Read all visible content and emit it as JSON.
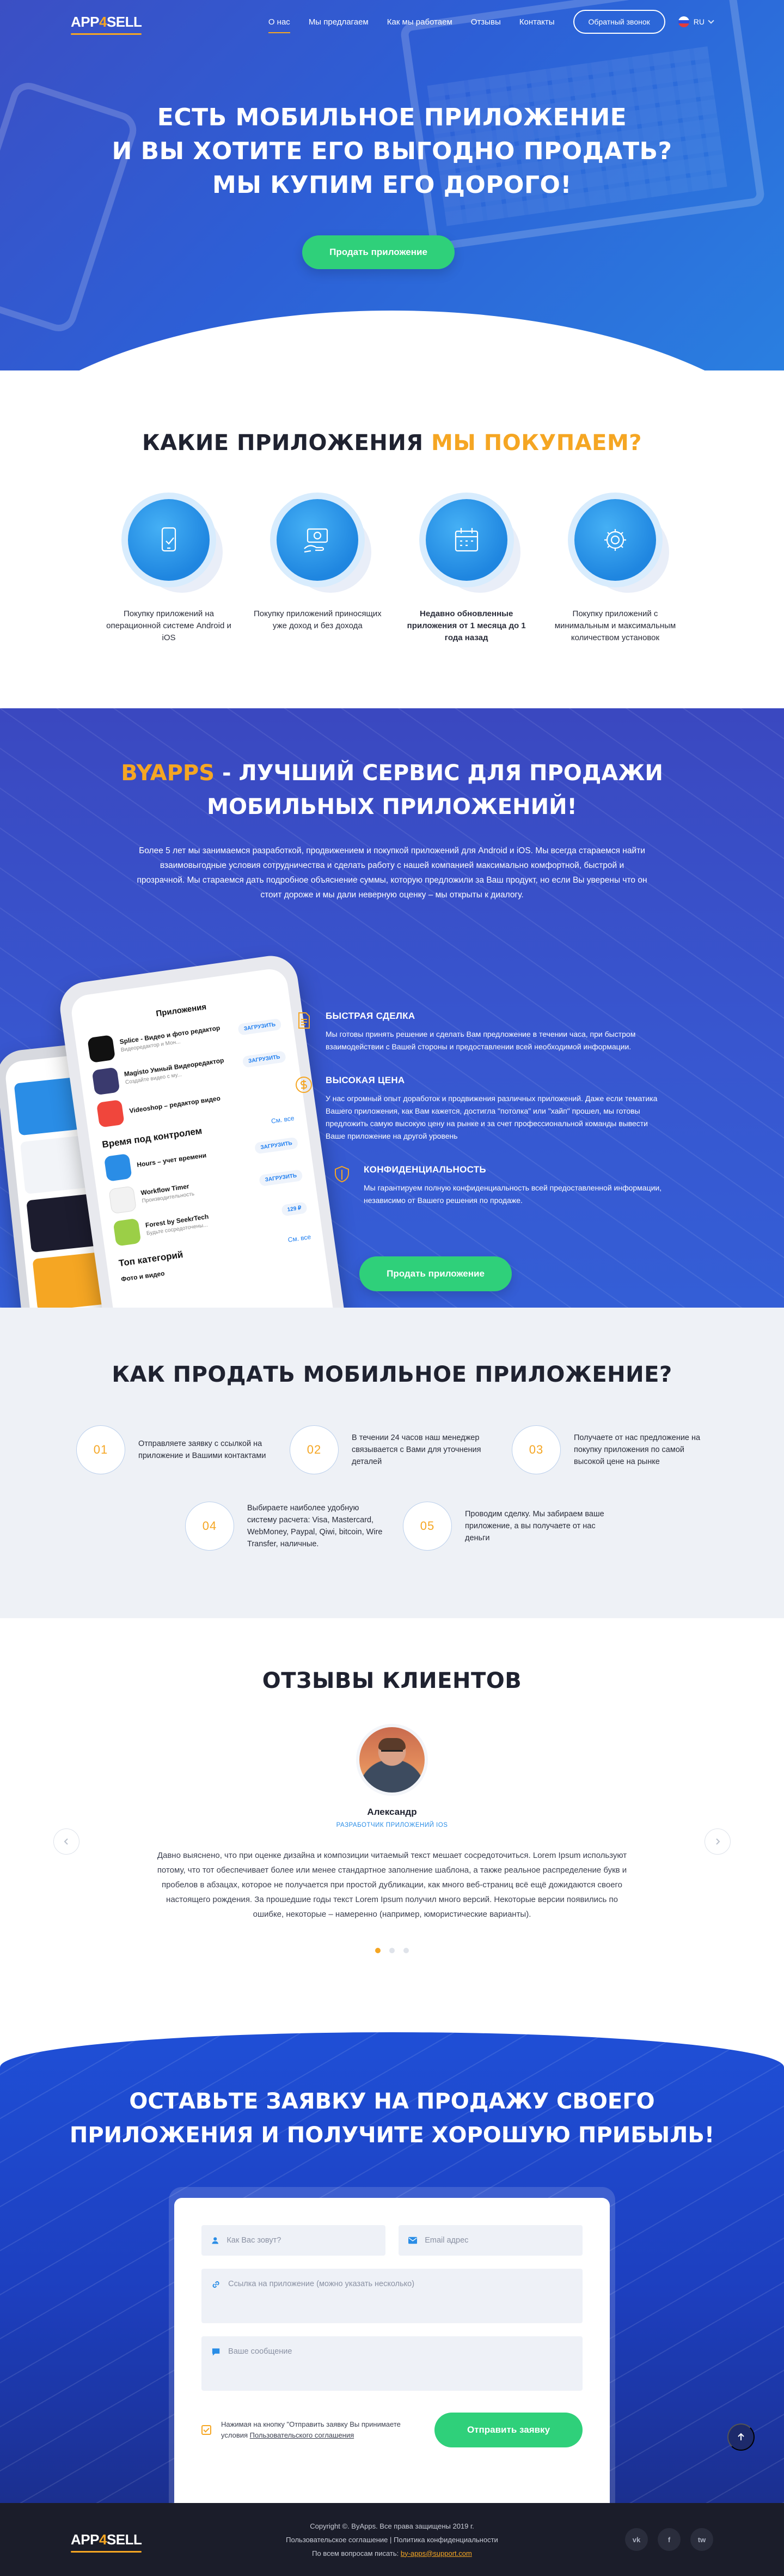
{
  "brand": {
    "logo_left": "APP",
    "logo_four": "4",
    "logo_right": "SELL"
  },
  "nav": {
    "items": [
      "О нас",
      "Мы предлагаем",
      "Как мы работаем",
      "Отзывы",
      "Контакты"
    ],
    "active_index": 0,
    "callback_label": "Обратный звонок",
    "lang": "RU"
  },
  "hero": {
    "title_lines": [
      "ЕСТЬ МОБИЛЬНОЕ ПРИЛОЖЕНИЕ",
      "И ВЫ ХОТИТЕ ЕГО ВЫГОДНО ПРОДАТЬ?",
      "МЫ КУПИМ ЕГО ДОРОГО!"
    ],
    "cta_label": "Продать приложение"
  },
  "buy": {
    "title_dark": "КАКИЕ ПРИЛОЖЕНИЯ",
    "title_orange": "МЫ ПОКУПАЕМ?",
    "features": [
      {
        "icon": "phone-check-icon",
        "text": "Покупку приложений на операционной системе Android и iOS",
        "bold": false
      },
      {
        "icon": "money-hand-icon",
        "text": "Покупку приложений приносящих уже доход и без дохода",
        "bold": false
      },
      {
        "icon": "calendar-icon",
        "text": "Недавно обновленные приложения от 1 месяца до 1 года назад",
        "bold": true
      },
      {
        "icon": "settings-gear-icon",
        "text": "Покупку приложений с минимальным и максимальным количеством установок",
        "bold": false
      }
    ]
  },
  "byapps": {
    "title_orange": "BYAPPS",
    "title_rest_1": " - ЛУЧШИЙ СЕРВИС ДЛЯ ПРОДАЖИ",
    "title_line_2": "МОБИЛЬНЫХ ПРИЛОЖЕНИЙ!",
    "lead": "Более 5 лет мы занимаемся разработкой, продвижением и покупкой приложений для Android и iOS. Мы всегда стараемся найти взаимовыгодные условия сотрудничества и сделать работу с нашей компанией максимально комфортной, быстрой и прозрачной. Мы стараемся дать подробное объяснение суммы, которую предложили за Ваш продукт, но если Вы уверены что он стоит дороже и мы дали неверную оценку – мы открыты к диалогу.",
    "benefits": [
      {
        "icon": "document-icon",
        "title": "БЫСТРАЯ СДЕЛКА",
        "text": "Мы готовы принять решение и сделать Вам предложение в течении часа, при быстром взаимодействии с Вашей стороны и предоставлении всей необходимой информации."
      },
      {
        "icon": "dollar-circle-icon",
        "title": "ВЫСОКАЯ ЦЕНА",
        "text": "У нас огромный опыт доработок и продвижения различных приложений. Даже если тематика Вашего приложения, как Вам кажется, достигла \"потолка\" или \"хайп\" прошел, мы готовы предложить самую высокую цену на рынке и за счет профессиональной команды вывести Ваше приложение на другой уровень"
      },
      {
        "icon": "shield-icon",
        "title": "КОНФИДЕНЦИАЛЬНОСТЬ",
        "text": "Мы гарантируем полную конфиденциальность всей предоставленной информации, независимо от Вашего решения по продаже."
      }
    ],
    "cta_label": "Продать приложение",
    "phone_screen": {
      "title": "Приложения",
      "apps": [
        {
          "name": "Splice - Видео и фото редактор",
          "sub": "Видеоредактор и Мон...",
          "btn": "ЗАГРУЗИТЬ",
          "color": "#111111"
        },
        {
          "name": "Magisto Умный Видеоредактор",
          "sub": "Создайте видео с му...",
          "btn": "ЗАГРУЗИТЬ",
          "color": "#3a3a6e"
        },
        {
          "name": "Videoshop – редактор видео",
          "sub": "",
          "btn": "",
          "color": "#f0463c"
        }
      ],
      "section": "Время под контролем",
      "section_link": "См. все",
      "apps2": [
        {
          "name": "Hours – учет времени",
          "sub": "",
          "btn": "ЗАГРУЗИТЬ",
          "color": "#2a8de6"
        },
        {
          "name": "Workflow Timer",
          "sub": "Производительность",
          "btn": "ЗАГРУЗИТЬ",
          "color": "#f2f2f2"
        },
        {
          "name": "Forest by SeekrTech",
          "sub": "Будьте сосредоточены...",
          "btn": "129 ₽",
          "color": "#9bcf47"
        }
      ],
      "section2": "Топ категорий",
      "section2_link": "См. все",
      "last_item": "Фото и видео"
    }
  },
  "how": {
    "title": "КАК ПРОДАТЬ МОБИЛЬНОЕ ПРИЛОЖЕНИЕ?",
    "steps": [
      {
        "num": "01",
        "text": "Отправляете заявку с ссылкой на приложение и Вашими контактами"
      },
      {
        "num": "02",
        "text": "В течении 24 часов наш менеджер связывается с Вами для уточнения деталей"
      },
      {
        "num": "03",
        "text": "Получаете от нас предложение на покупку приложения по самой высокой цене на рынке"
      },
      {
        "num": "04",
        "text": "Выбираете наиболее удобную систему расчета: Visa, Mastercard, WebMoney, Paypal, Qiwi, bitcoin, Wire Transfer, наличные."
      },
      {
        "num": "05",
        "text": "Проводим сделку. Мы забираем ваше приложение, а вы получаете от нас деньги"
      }
    ]
  },
  "reviews": {
    "title": "ОТЗЫВЫ КЛИЕНТОВ",
    "name": "Александр",
    "role": "РАЗРАБОТЧИК ПРИЛОЖЕНИЙ IOS",
    "text": "Давно выяснено, что при оценке дизайна и композиции читаемый текст мешает сосредоточиться. Lorem Ipsum используют потому, что тот обеспечивает более или менее стандартное заполнение шаблона, а также реальное распределение букв и пробелов в абзацах, которое не получается при простой дубликации, как много веб-страниц всё ещё дожидаются своего настоящего рождения. За прошедшие годы текст Lorem Ipsum получил много версий. Некоторые версии появились по ошибке, некоторые – намеренно (например, юмористические варианты).",
    "active_dot": 0,
    "dot_count": 3
  },
  "order": {
    "title_lines": [
      "ОСТАВЬТЕ ЗАЯВКУ НА ПРОДАЖУ СВОЕГО",
      "ПРИЛОЖЕНИЯ И ПОЛУЧИТЕ ХОРОШУЮ ПРИБЫЛЬ!"
    ],
    "name_placeholder": "Как Вас зовут?",
    "email_placeholder": "Email адрес",
    "link_placeholder": "Ссылка на приложение (можно указать несколько)",
    "message_placeholder": "Ваше сообщение",
    "consent_text": "Нажимая на кнопку \"Отправить заявку Вы принимаете условия ",
    "consent_link": "Пользовательского соглашения",
    "submit_label": "Отправить заявку"
  },
  "footer": {
    "copyright": "Copyright ©. ByApps. Все права защищены 2019 г.",
    "links": "Пользовательское соглашение | Политика конфиденциальности",
    "contact_prefix": "По всем вопросам писать: ",
    "contact_email": "by-apps@support.com",
    "socials": [
      "vk",
      "f",
      "tw"
    ]
  }
}
